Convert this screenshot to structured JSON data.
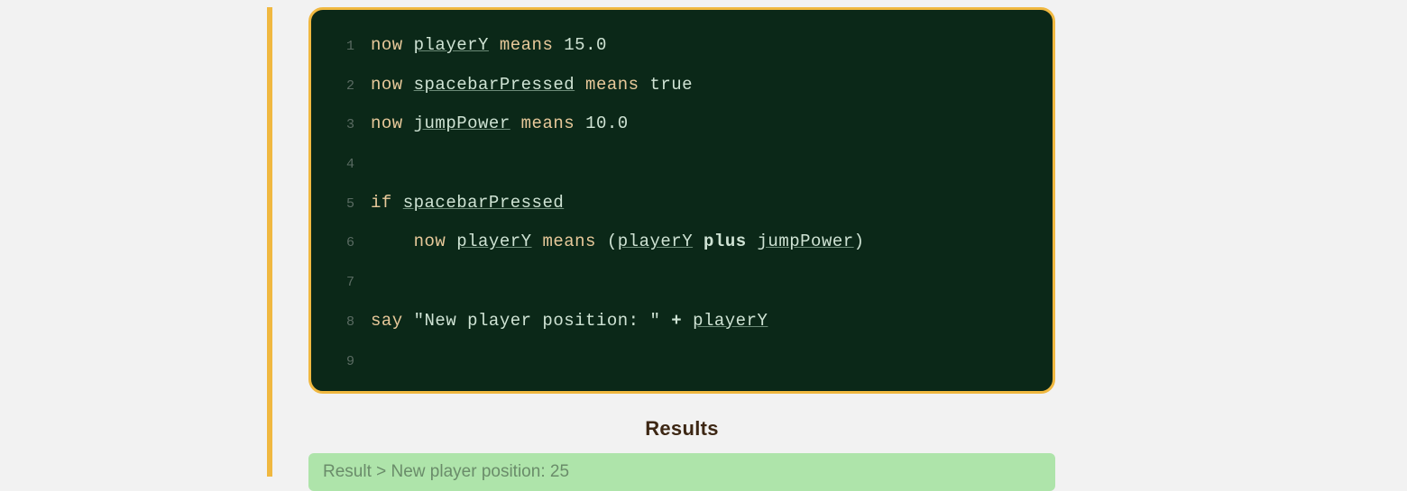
{
  "code": {
    "lines": [
      {
        "num": "1",
        "tokens": [
          {
            "t": "kw",
            "v": "now "
          },
          {
            "t": "var",
            "v": "playerY"
          },
          {
            "t": "kw",
            "v": " means "
          },
          {
            "t": "num",
            "v": "15.0"
          }
        ]
      },
      {
        "num": "2",
        "tokens": [
          {
            "t": "kw",
            "v": "now "
          },
          {
            "t": "var",
            "v": "spacebarPressed"
          },
          {
            "t": "kw",
            "v": " means "
          },
          {
            "t": "bool",
            "v": "true"
          }
        ]
      },
      {
        "num": "3",
        "tokens": [
          {
            "t": "kw",
            "v": "now "
          },
          {
            "t": "var",
            "v": "jumpPower"
          },
          {
            "t": "kw",
            "v": " means "
          },
          {
            "t": "num",
            "v": "10.0"
          }
        ]
      },
      {
        "num": "4",
        "tokens": []
      },
      {
        "num": "5",
        "tokens": [
          {
            "t": "kw",
            "v": "if "
          },
          {
            "t": "var",
            "v": "spacebarPressed"
          }
        ]
      },
      {
        "num": "6",
        "tokens": [
          {
            "t": "plain",
            "v": "    "
          },
          {
            "t": "kw",
            "v": "now "
          },
          {
            "t": "var",
            "v": "playerY"
          },
          {
            "t": "kw",
            "v": " means "
          },
          {
            "t": "paren",
            "v": "("
          },
          {
            "t": "var",
            "v": "playerY"
          },
          {
            "t": "plain",
            "v": " "
          },
          {
            "t": "op",
            "v": "plus"
          },
          {
            "t": "plain",
            "v": " "
          },
          {
            "t": "var",
            "v": "jumpPower"
          },
          {
            "t": "paren",
            "v": ")"
          }
        ]
      },
      {
        "num": "7",
        "tokens": []
      },
      {
        "num": "8",
        "tokens": [
          {
            "t": "kw",
            "v": "say "
          },
          {
            "t": "str",
            "v": "\"New player position: \""
          },
          {
            "t": "plain",
            "v": " "
          },
          {
            "t": "op",
            "v": "+"
          },
          {
            "t": "plain",
            "v": " "
          },
          {
            "t": "var",
            "v": "playerY"
          }
        ]
      },
      {
        "num": "9",
        "tokens": []
      }
    ]
  },
  "results": {
    "heading": "Results",
    "output": "Result > New player position: 25"
  }
}
